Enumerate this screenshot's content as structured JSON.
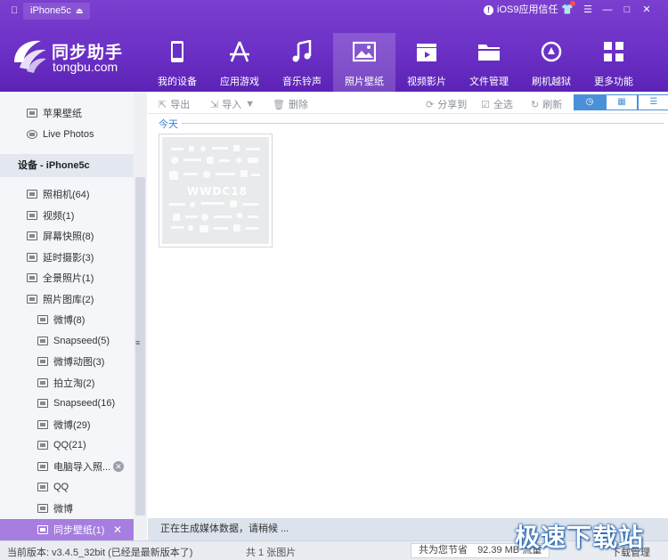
{
  "titlebar": {
    "device_name": "iPhone5c",
    "ios_trust": "iOS9应用信任"
  },
  "logo": {
    "cn": "同步助手",
    "en": "tongbu.com"
  },
  "nav": [
    {
      "label": "我的设备",
      "icon": "phone-icon"
    },
    {
      "label": "应用游戏",
      "icon": "app-store-icon"
    },
    {
      "label": "音乐铃声",
      "icon": "music-note-icon"
    },
    {
      "label": "照片壁纸",
      "icon": "picture-icon"
    },
    {
      "label": "视频影片",
      "icon": "clapperboard-icon"
    },
    {
      "label": "文件管理",
      "icon": "folder-icon"
    },
    {
      "label": "刷机越狱",
      "icon": "jailbreak-icon"
    },
    {
      "label": "更多功能",
      "icon": "grid-icon"
    }
  ],
  "active_nav": "照片壁纸",
  "sidebar": {
    "top_items": [
      {
        "label": "苹果壁纸"
      },
      {
        "label": "Live Photos"
      }
    ],
    "section": "设备 - iPhone5c",
    "items": [
      {
        "label": "照相机(64)"
      },
      {
        "label": "视频(1)"
      },
      {
        "label": "屏幕快照(8)"
      },
      {
        "label": "延时摄影(3)"
      },
      {
        "label": "全景照片(1)"
      },
      {
        "label": "照片图库(2)"
      }
    ],
    "sub_items": [
      {
        "label": "微博(8)"
      },
      {
        "label": "Snapseed(5)"
      },
      {
        "label": "微博动图(3)"
      },
      {
        "label": "拍立淘(2)"
      },
      {
        "label": "Snapseed(16)"
      },
      {
        "label": "微博(29)"
      },
      {
        "label": "QQ(21)"
      },
      {
        "label": "电脑导入照..."
      },
      {
        "label": "QQ"
      },
      {
        "label": "微博"
      },
      {
        "label": "同步壁纸(1)"
      }
    ]
  },
  "toolbar": {
    "export": "导出",
    "import": "导入",
    "delete": "删除",
    "share": "分享到",
    "select_all": "全选",
    "refresh": "刷新"
  },
  "content": {
    "group_title": "今天",
    "thumbnail_text": "WWDC18",
    "status": "正在生成媒体数据，请稍候 ..."
  },
  "statusbar": {
    "version": "当前版本: v3.4.5_32bit  (已经是最新版本了)",
    "count": "共 1 张图片",
    "saved_prefix": "共为您节省",
    "saved_value": "92.39 MB 流量",
    "download": "下载管理"
  },
  "watermark": "极速下载站",
  "colors": {
    "header": "#6a2fc4",
    "selected": "#a57ee0",
    "accent": "#4a90d9"
  }
}
